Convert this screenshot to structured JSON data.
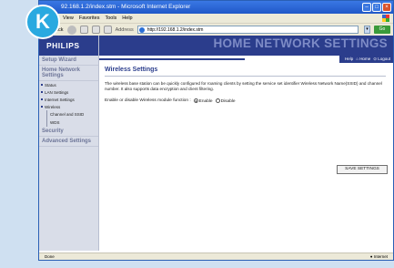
{
  "badge": "K",
  "window": {
    "title": "92.168.1.2/index.stm - Microsoft Internet Explorer",
    "menu": [
      "View",
      "Favorites",
      "Tools",
      "Help"
    ],
    "toolbar": {
      "back_label": "ack",
      "address_label": "Address",
      "address_value": "http://192.168.1.2/index.stm",
      "go_label": "Go"
    },
    "status_left": "Done",
    "status_right": "Internet"
  },
  "router": {
    "brand": "PHILIPS",
    "banner_title": "HOME NETWORK SETTINGS",
    "top_links": [
      "Help",
      "Home",
      "Logout"
    ],
    "sidebar": {
      "setup_wizard": "Setup Wizard",
      "home_network": "Home Network Settings",
      "items": [
        "Status",
        "LAN Settings",
        "Internet Settings",
        "Wireless"
      ],
      "wireless_items": [
        "Channel and SSID",
        "WDS"
      ],
      "security": "Security",
      "advanced": "Advanced Settings"
    },
    "main": {
      "title": "Wireless Settings",
      "description": "The wireless base station can be quickly configured for roaming clients by setting the service set identifier Wireless Network Name(SSID) and channel number. It also supports data encryption and client filtering.",
      "toggle_label": "Enable or disable Wireless module function :",
      "enable_label": "Enable",
      "disable_label": "Disable",
      "selected": "Enable",
      "save_label": "SAVE SETTINGS"
    }
  }
}
